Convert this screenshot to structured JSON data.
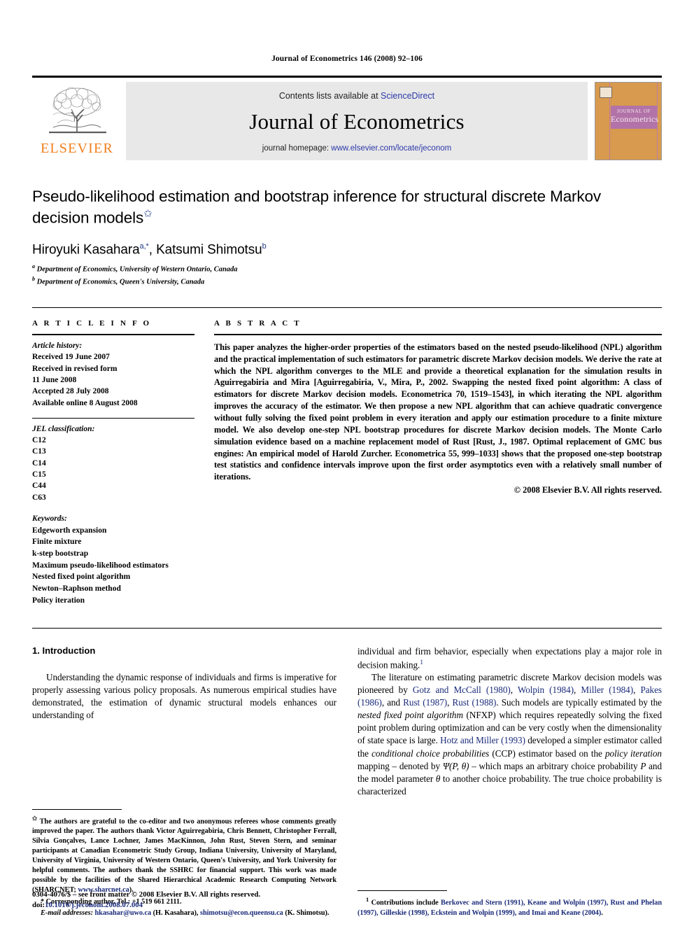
{
  "running_head": "Journal of Econometrics 146 (2008) 92–106",
  "masthead": {
    "elsevier_wordmark": "ELSEVIER",
    "contents_prefix": "Contents lists available at ",
    "contents_link": "ScienceDirect",
    "journal_title": "Journal of Econometrics",
    "homepage_prefix": "journal homepage: ",
    "homepage_url": "www.elsevier.com/locate/jeconom",
    "cover": {
      "line1": "JOURNAL OF",
      "line2": "Econometrics"
    },
    "colors": {
      "elsevier_orange": "#f07f1a",
      "link_blue": "#2b38a8",
      "band_gray": "#e8e8e8",
      "cover_tan": "#d79a4e",
      "cover_purple": "#b273a8"
    }
  },
  "title_block": {
    "title": "Pseudo-likelihood estimation and bootstrap inference for structural discrete Markov decision models",
    "title_star": "✩",
    "authors": [
      {
        "name": "Hiroyuki Kasahara",
        "marks": "a,*"
      },
      {
        "name": "Katsumi Shimotsu",
        "marks": "b"
      }
    ],
    "affiliations": [
      {
        "mark": "a",
        "text": "Department of Economics, University of Western Ontario, Canada"
      },
      {
        "mark": "b",
        "text": "Department of Economics, Queen's University, Canada"
      }
    ]
  },
  "article_info": {
    "heading": "A R T I C L E   I N F O",
    "history_label": "Article history:",
    "history": [
      "Received 19 June 2007",
      "Received in revised form",
      "11 June 2008",
      "Accepted 28 July 2008",
      "Available online 8 August 2008"
    ],
    "jel_label": "JEL classification:",
    "jel_codes": [
      "C12",
      "C13",
      "C14",
      "C15",
      "C44",
      "C63"
    ],
    "keywords_label": "Keywords:",
    "keywords": [
      "Edgeworth expansion",
      "Finite mixture",
      "k-step bootstrap",
      "Maximum pseudo-likelihood estimators",
      "Nested fixed point algorithm",
      "Newton–Raphson method",
      "Policy iteration"
    ]
  },
  "abstract": {
    "heading": "A B S T R A C T",
    "text": "This paper analyzes the higher-order properties of the estimators based on the nested pseudo-likelihood (NPL) algorithm and the practical implementation of such estimators for parametric discrete Markov decision models. We derive the rate at which the NPL algorithm converges to the MLE and provide a theoretical explanation for the simulation results in Aguirregabiria and Mira [Aguirregabiria, V., Mira, P., 2002. Swapping the nested fixed point algorithm: A class of estimators for discrete Markov decision models. Econometrica 70, 1519–1543], in which iterating the NPL algorithm improves the accuracy of the estimator. We then propose a new NPL algorithm that can achieve quadratic convergence without fully solving the fixed point problem in every iteration and apply our estimation procedure to a finite mixture model. We also develop one-step NPL bootstrap procedures for discrete Markov decision models. The Monte Carlo simulation evidence based on a machine replacement model of Rust [Rust, J., 1987. Optimal replacement of GMC bus engines: An empirical model of Harold Zurcher. Econometrica 55, 999–1033] shows that the proposed one-step bootstrap test statistics and confidence intervals improve upon the first order asymptotics even with a relatively small number of iterations.",
    "copyright": "© 2008 Elsevier B.V. All rights reserved."
  },
  "introduction": {
    "section_number_title": "1. Introduction",
    "para1_left": "Understanding the dynamic response of individuals and firms is imperative for properly assessing various policy proposals. As numerous empirical studies have demonstrated, the estimation of dynamic structural models enhances our understanding of",
    "para1_right_cont": "individual and firm behavior, especially when expectations play a major role in decision making.",
    "para1_footnote_mark": "1",
    "para2_seg1": "The literature on estimating parametric discrete Markov decision models was pioneered by ",
    "para2_cites_a": "Gotz and McCall (1980)",
    "para2_sep1": ", ",
    "para2_cites_b": "Wolpin (1984)",
    "para2_sep2": ", ",
    "para2_cites_c": "Miller (1984)",
    "para2_sep3": ", ",
    "para2_cites_d": "Pakes (1986)",
    "para2_sep4": ", and ",
    "para2_cites_e": "Rust (1987)",
    "para2_sep5": ", ",
    "para2_cites_f": "Rust (1988)",
    "para2_seg2": ". Such models are typically estimated by the ",
    "para2_ital1": "nested fixed point algorithm",
    "para2_seg3": " (NFXP) which requires repeatedly solving the fixed point problem during optimization and can be very costly when the dimensionality of state space is large. ",
    "para2_cites_g": "Hotz and Miller (1993)",
    "para2_seg4": " developed a simpler estimator called the ",
    "para2_ital2": "conditional choice probabilities",
    "para2_seg5": " (CCP) estimator based on the ",
    "para2_ital3": "policy iteration",
    "para2_seg6": " mapping – denoted by ",
    "para2_math1": "Ψ(P, θ)",
    "para2_seg7": " – which maps an arbitrary choice probability ",
    "para2_math2": "P",
    "para2_seg8": " and the model parameter ",
    "para2_math3": "θ",
    "para2_seg9": " to another choice probability. The true choice probability is characterized"
  },
  "footnotes": {
    "left": {
      "star_mark": "✩",
      "star_text": "The authors are grateful to the co-editor and two anonymous referees whose comments greatly improved the paper. The authors thank Victor Aguirregabiria, Chris Bennett, Christopher Ferrall, Silvia Gonçalves, Lance Lochner, James MacKinnon, John Rust, Steven Stern, and seminar participants at Canadian Econometric Study Group, Indiana University, University of Maryland, University of Virginia, University of Western Ontario, Queen's University, and York University for helpful comments. The authors thank the SSHRC for financial support. This work was made possible by the facilities of the Shared Hierarchical Academic Research Computing Network (SHARCNET; ",
      "star_link": "www.sharcnet.ca",
      "star_text_end": ").",
      "corresponding_mark": "*",
      "corresponding_text": "Corresponding author. Tel.: +1 519 661 2111.",
      "email_label": "E-mail addresses:",
      "email_1": "hkasahar@uwo.ca",
      "email_1_who": " (H. Kasahara), ",
      "email_2": "shimotsu@econ.queensu.ca",
      "email_2_who": " (K. Shimotsu)."
    },
    "right": {
      "mark": "1",
      "prefix": "Contributions include ",
      "cites": "Berkovec and Stern (1991), Keane and Wolpin (1997), Rust and Phelan (1997), Gilleskie (1998), Eckstein and Wolpin (1999), and Imai and Keane (2004)",
      "suffix": "."
    }
  },
  "colophon": {
    "issn_line": "0304-4076/$ – see front matter © 2008 Elsevier B.V. All rights reserved.",
    "doi_prefix": "doi:",
    "doi": "10.1016/j.jeconom.2008.07.004"
  }
}
